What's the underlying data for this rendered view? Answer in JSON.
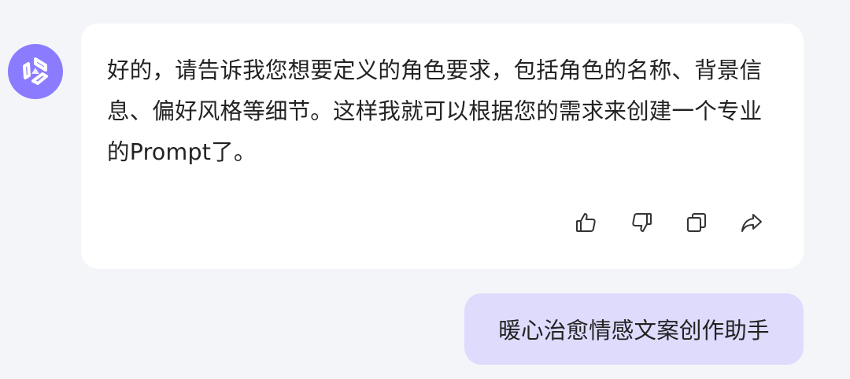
{
  "assistant": {
    "avatar_icon": "assistant-logo-icon",
    "message": "好的，请告诉我您想要定义的角色要求，包括角色的名称、背景信息、偏好风格等细节。这样我就可以根据您的需求来创建一个专业的Prompt了。",
    "actions": [
      {
        "name": "like",
        "icon": "thumbs-up-icon"
      },
      {
        "name": "dislike",
        "icon": "thumbs-down-icon"
      },
      {
        "name": "copy",
        "icon": "copy-icon"
      },
      {
        "name": "share",
        "icon": "share-icon"
      }
    ]
  },
  "user": {
    "message": "暖心治愈情感文案创作助手"
  },
  "colors": {
    "background": "#f4f5f9",
    "assistant_bubble": "#ffffff",
    "user_bubble": "#dedbfd",
    "avatar": "#8a7bff",
    "text": "#222222",
    "icon": "#333333"
  }
}
